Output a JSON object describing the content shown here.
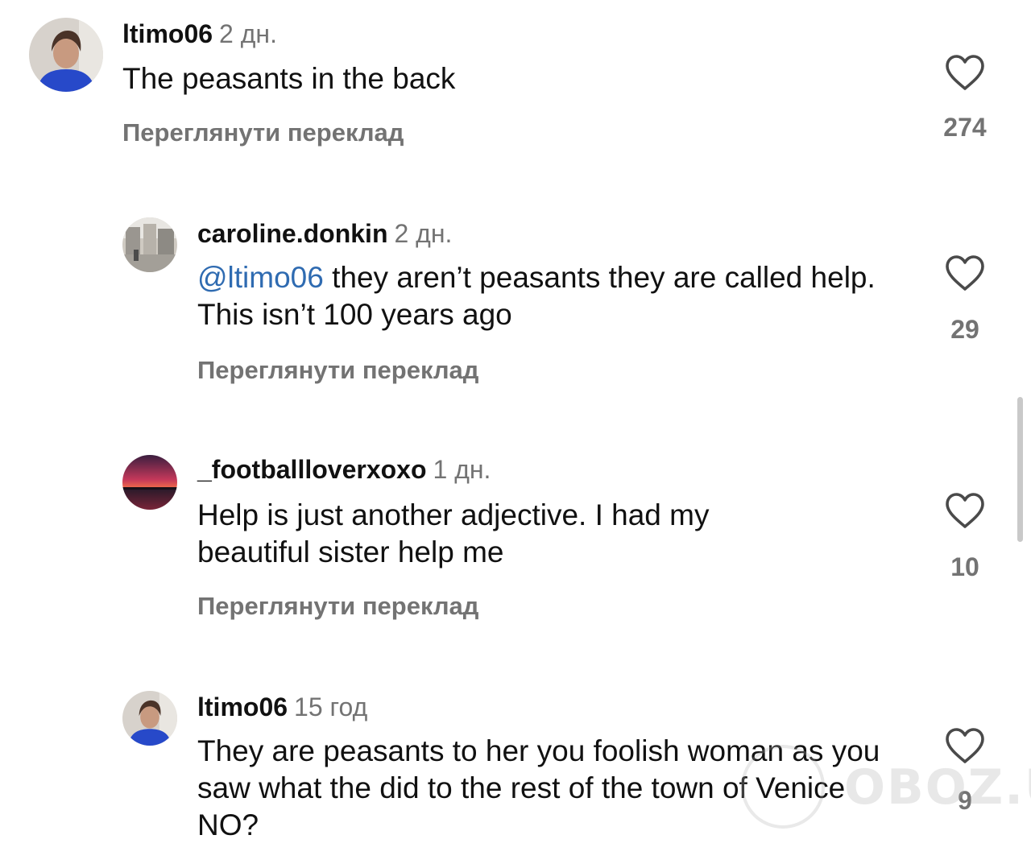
{
  "comments": [
    {
      "username": "ltimo06",
      "time": "2 дн.",
      "text": "The peasants in the back",
      "translate": "Переглянути переклад",
      "likes": "274",
      "avatar": "woman-blue-shirt"
    },
    {
      "username": "caroline.donkin",
      "time": "2 дн.",
      "mention": "@ltimo06",
      "text": " they aren’t peasants they are called help.  This isn’t 100 years ago",
      "translate": "Переглянути переклад",
      "likes": "29",
      "avatar": "street-photo"
    },
    {
      "username": "_footballloverxoxo",
      "time": "1 дн.",
      "text": "Help is just another adjective.  I had my beautiful sister help me",
      "translate": "Переглянути переклад",
      "likes": "10",
      "avatar": "sunset-over-water"
    },
    {
      "username": "ltimo06",
      "time": "15 год",
      "text": "They are peasants to her you foolish woman as you saw what the did to the rest of the town of Venice NO?",
      "likes": "9",
      "avatar": "woman-blue-shirt"
    }
  ],
  "watermark": "OBOZ.UA",
  "icons": {
    "like": "heart-outline-icon"
  },
  "colors": {
    "mention": "#2f6bb1",
    "secondary_text": "#737373"
  }
}
